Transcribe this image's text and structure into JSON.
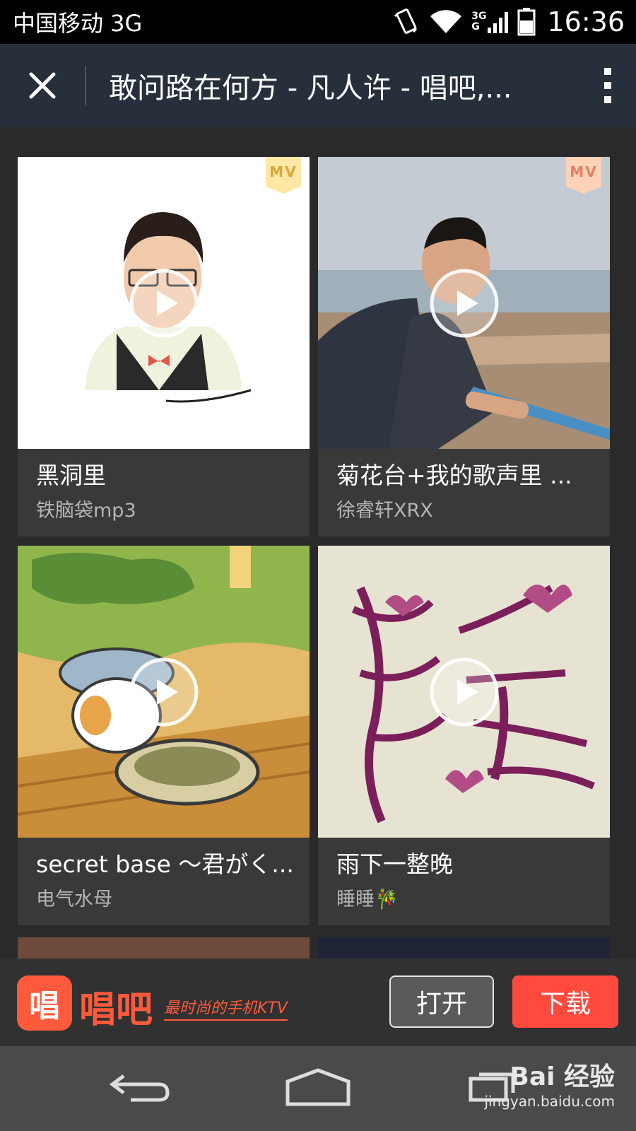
{
  "status_bar": {
    "carrier": "中国移动 3G",
    "network_top": "3G",
    "network_bottom": "G",
    "time": "16:36"
  },
  "toolbar": {
    "title": "敢问路在何方 - 凡人许 - 唱吧,..."
  },
  "cards": [
    {
      "title": "黑洞里",
      "artist": "铁脑袋mp3",
      "badge": "MV"
    },
    {
      "title": "菊花台+我的歌声里 ...",
      "artist": "徐睿轩XRX",
      "badge": "MV"
    },
    {
      "title": "secret base ～君がく...",
      "artist": "电气水母",
      "badge": ""
    },
    {
      "title": "雨下一整晚",
      "artist": "睡睡🎋",
      "badge": ""
    }
  ],
  "app_banner": {
    "icon_text": "唱",
    "app_name": "唱吧",
    "slogan": "最时尚的手机KTV",
    "open_label": "打开",
    "download_label": "下载"
  },
  "watermark": {
    "main": "Bai 经验",
    "sub": "jingyan.baidu.com"
  },
  "colors": {
    "accent": "#ff5a3c",
    "toolbar_bg": "#27303a",
    "card_bg": "#3a393a"
  }
}
